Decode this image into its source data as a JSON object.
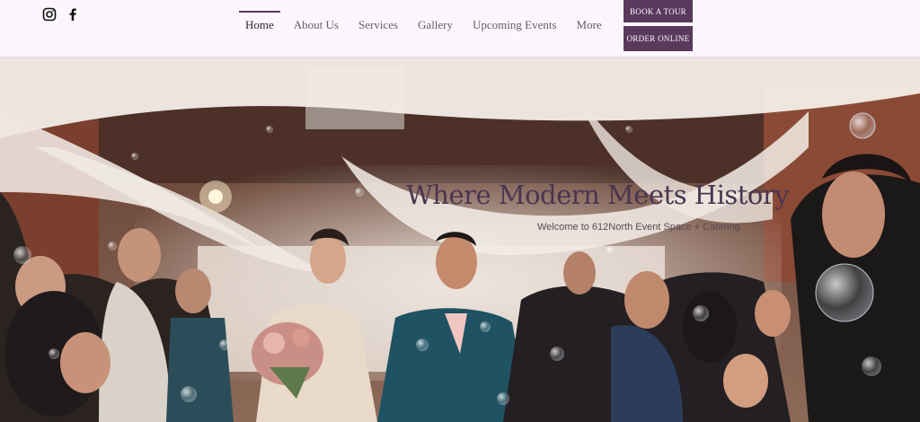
{
  "social": [
    {
      "name": "instagram",
      "icon": "instagram-icon"
    },
    {
      "name": "facebook",
      "icon": "facebook-icon"
    }
  ],
  "nav": {
    "items": [
      {
        "label": "Home",
        "active": true
      },
      {
        "label": "About Us",
        "active": false
      },
      {
        "label": "Services",
        "active": false
      },
      {
        "label": "Gallery",
        "active": false
      },
      {
        "label": "Upcoming Events",
        "active": false
      },
      {
        "label": "More",
        "active": false
      }
    ]
  },
  "cta": {
    "book_tour": "BOOK A TOUR",
    "order_online": "ORDER ONLINE"
  },
  "hero": {
    "title": "Where Modern Meets History",
    "subtitle": "Welcome to 612North Event Space + Catering"
  },
  "colors": {
    "accent": "#59395c",
    "header_bg": "#fcf7fc",
    "title": "#4a3550"
  }
}
